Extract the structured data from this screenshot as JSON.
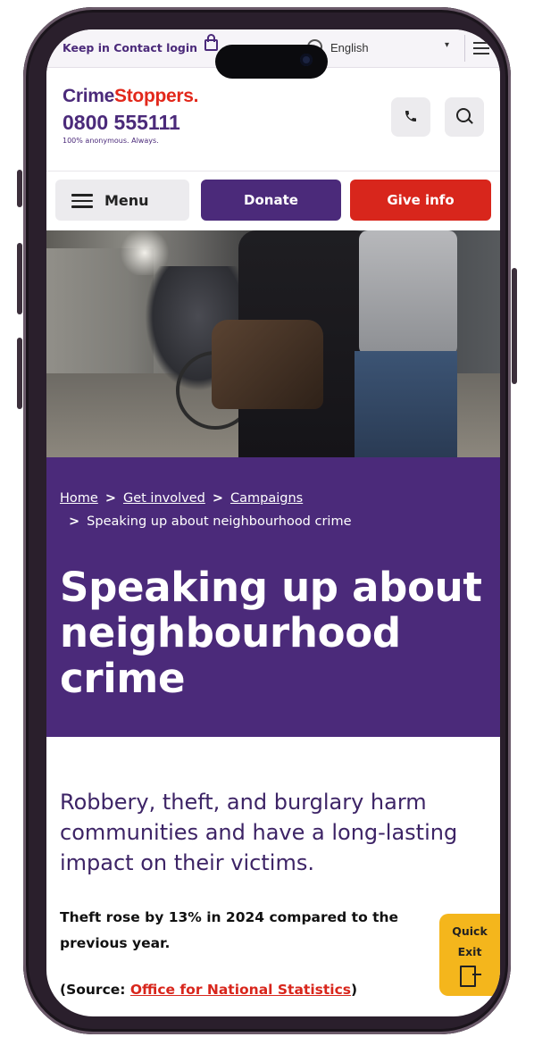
{
  "topbar": {
    "contact_login": "Keep in Contact login",
    "language": "English"
  },
  "header": {
    "logo_part1": "Crime",
    "logo_part2": "Stoppers.",
    "phone": "0800 555111",
    "tagline": "100% anonymous. Always."
  },
  "nav": {
    "menu_label": "Menu",
    "donate_label": "Donate",
    "give_info_label": "Give info"
  },
  "breadcrumb": {
    "items": [
      "Home",
      "Get involved",
      "Campaigns"
    ],
    "current": "Speaking up about neighbourhood crime"
  },
  "page": {
    "title": "Speaking up about neighbourhood crime",
    "lead": "Robbery, theft, and burglary harm communities and have a long-lasting impact on their victims.",
    "stat": "Theft rose by 13% in 2024 compared to the previous year.",
    "source_prefix": "(Source: ",
    "source_link": "Office for National Statistics",
    "source_suffix": ")"
  },
  "quick_exit": {
    "line1": "Quick",
    "line2": "Exit"
  },
  "colors": {
    "brand_purple": "#4b2a7a",
    "brand_red": "#d8261c",
    "quick_exit": "#f4b61c"
  },
  "icons": [
    "lock-icon",
    "globe-icon",
    "hamburger-icon",
    "phone-icon",
    "search-icon",
    "menu-icon",
    "chevron-right-icon",
    "door-exit-icon"
  ]
}
